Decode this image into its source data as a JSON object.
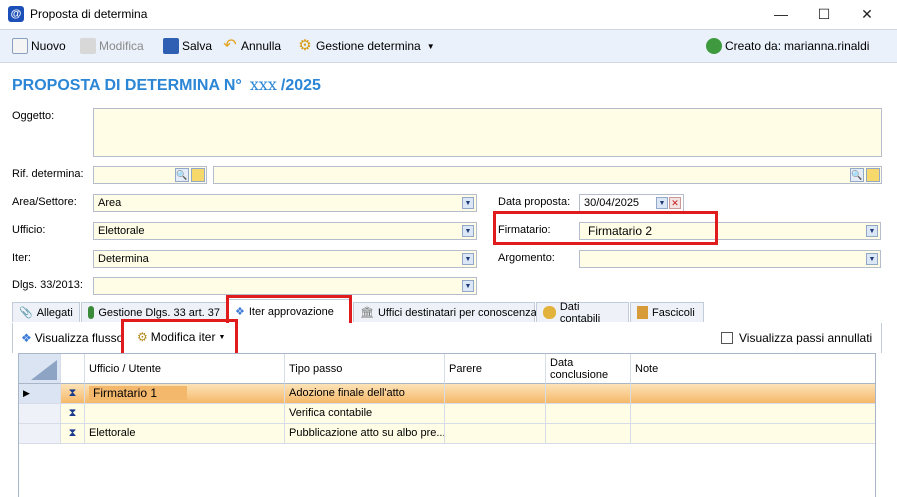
{
  "window": {
    "title": "Proposta di determina",
    "minimize": "—",
    "maximize": "☐",
    "close": "✕"
  },
  "toolbar": {
    "nuovo": "Nuovo",
    "modifica": "Modifica",
    "salva": "Salva",
    "annulla": "Annulla",
    "gestione": "Gestione determina",
    "creato_da_label": "Creato da:",
    "creato_da_user": "marianna.rinaldi"
  },
  "header": {
    "title_prefix": "PROPOSTA DI DETERMINA N°",
    "number": "xxx",
    "year": "/2025"
  },
  "form": {
    "oggetto_label": "Oggetto:",
    "oggetto_value": "",
    "rif_label": "Rif. determina:",
    "area_label": "Area/Settore:",
    "area_value": "Area",
    "ufficio_label": "Ufficio:",
    "ufficio_value": "Elettorale",
    "iter_label": "Iter:",
    "iter_value": "Determina",
    "dlgs_label": "Dlgs. 33/2013:",
    "dlgs_value": "",
    "data_proposta_label": "Data proposta:",
    "data_proposta_value": "30/04/2025",
    "firmatario_label": "Firmatario:",
    "firmatario_value": "Firmatario 2",
    "argomento_label": "Argomento:",
    "argomento_value": ""
  },
  "tabs": [
    {
      "label": "Allegati"
    },
    {
      "label": "Gestione Dlgs. 33 art. 37"
    },
    {
      "label": "Iter approvazione"
    },
    {
      "label": "Uffici destinatari per conoscenza"
    },
    {
      "label": "Dati contabili"
    },
    {
      "label": "Fascicoli"
    }
  ],
  "iter_toolbar": {
    "visualizza_flusso": "Visualizza flusso",
    "modifica_iter": "Modifica iter",
    "visualizza_passi_annullati": "Visualizza passi annullati"
  },
  "grid": {
    "columns": [
      "Ufficio / Utente",
      "Tipo passo",
      "Parere",
      "Data conclusione",
      "Note"
    ],
    "rows": [
      {
        "ufficio": "Firmatario 1",
        "tipo": "Adozione finale dell'atto",
        "parere": "",
        "data": "",
        "note": ""
      },
      {
        "ufficio": "",
        "tipo": "Verifica contabile",
        "parere": "",
        "data": "",
        "note": ""
      },
      {
        "ufficio": "Elettorale",
        "tipo": "Pubblicazione atto su albo pre...",
        "parere": "",
        "data": "",
        "note": ""
      }
    ]
  },
  "colors": {
    "accent": "#2b86d6",
    "highlight": "#e01b1b",
    "selected_row": "#f7c07a"
  }
}
